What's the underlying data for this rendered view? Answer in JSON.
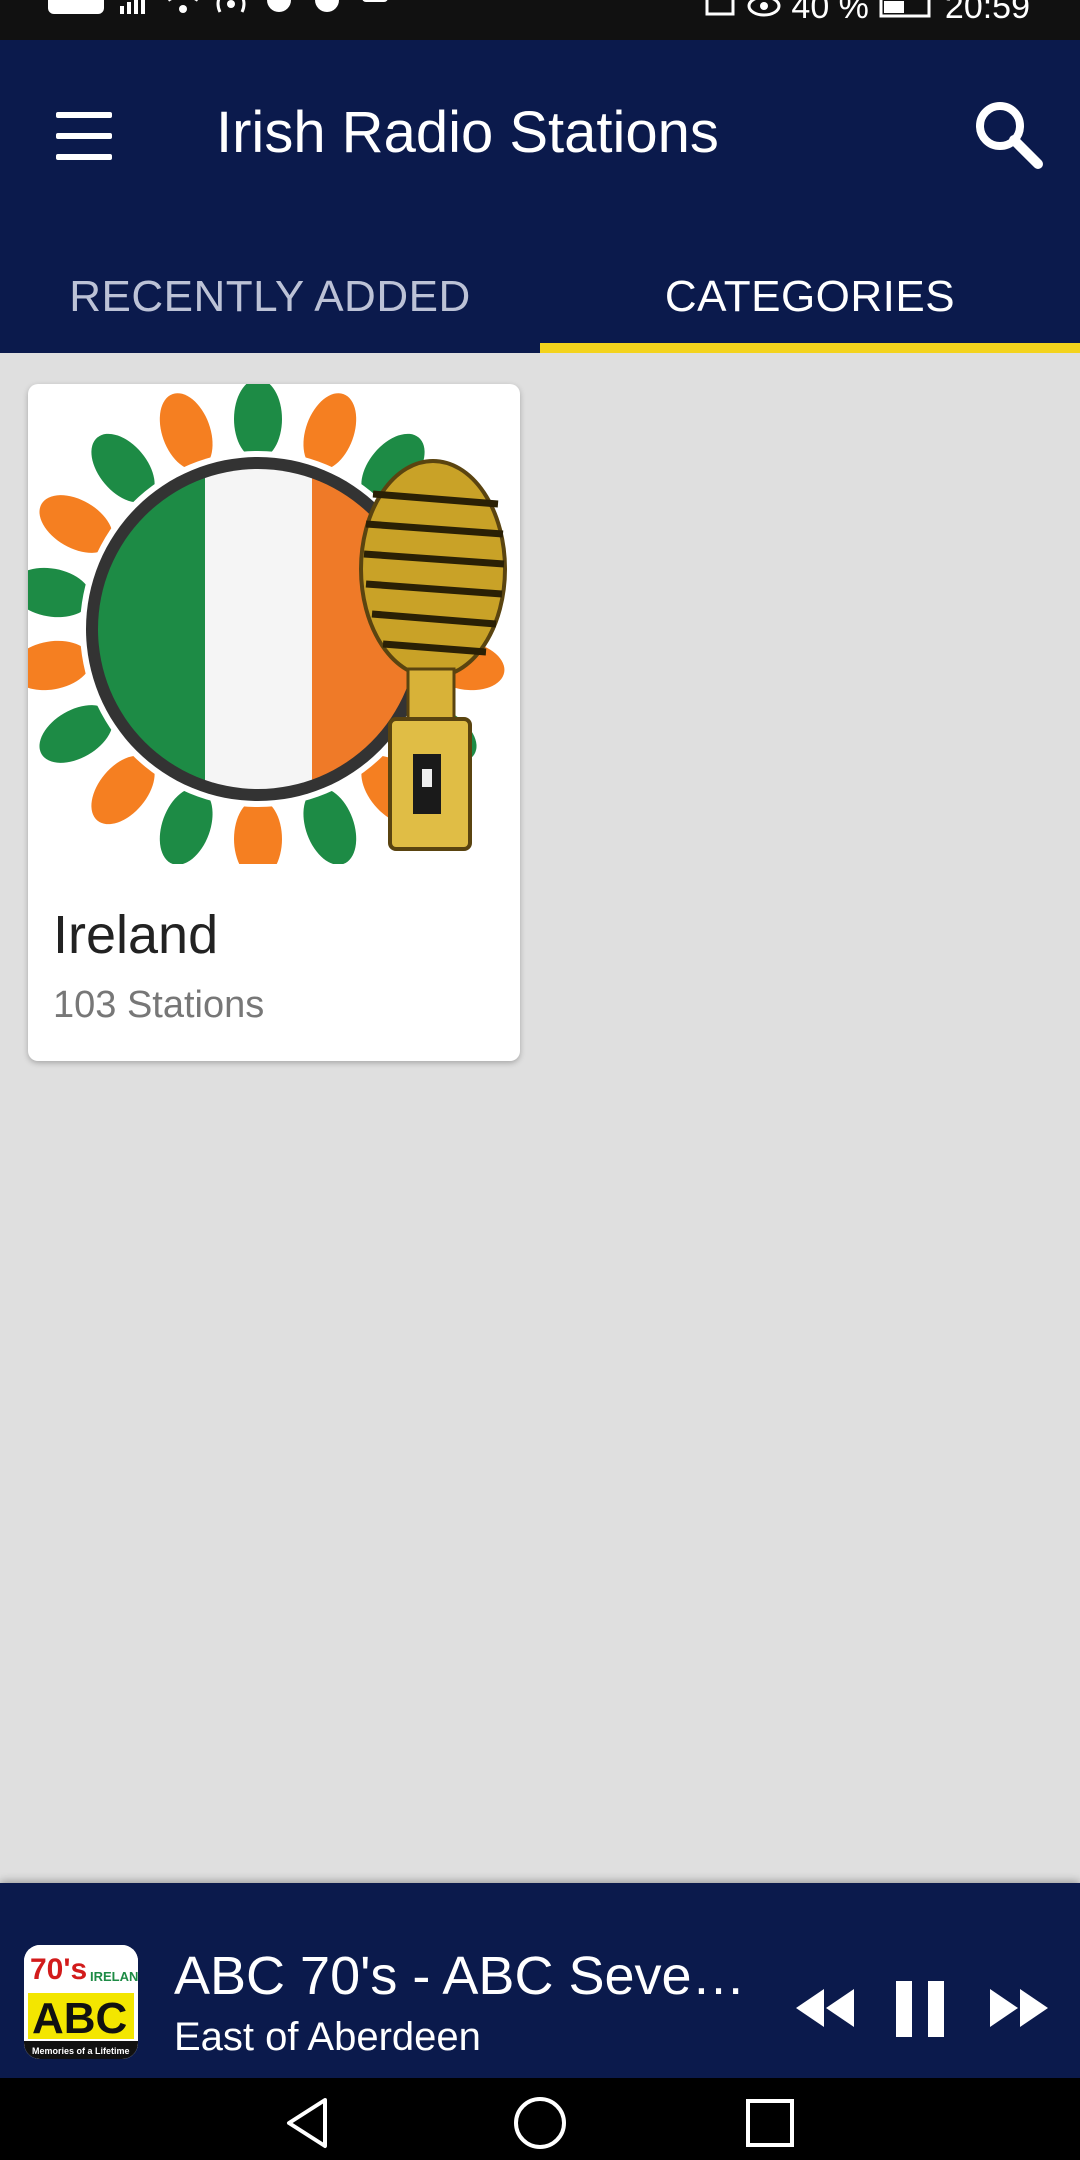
{
  "app": {
    "title": "Irish Radio Stations"
  },
  "status_bar": {
    "battery": "40 %",
    "time": "20:59"
  },
  "tabs": [
    {
      "label": "RECENTLY ADDED",
      "active": false
    },
    {
      "label": "CATEGORIES",
      "active": true
    }
  ],
  "categories": [
    {
      "name": "Ireland",
      "count": "103 Stations"
    }
  ],
  "player": {
    "title": "ABC 70's - ABC Sevent...",
    "subtitle": "East of Aberdeen",
    "logo_text": {
      "top": "70's",
      "tag": "IRELAND",
      "main": "ABC",
      "foot": "Memories of a Lifetime"
    },
    "controls": [
      "rewind-icon",
      "pause-icon",
      "fast-forward-icon"
    ]
  },
  "icons": [
    "menu-icon",
    "search-icon",
    "back-icon",
    "home-icon",
    "recents-icon"
  ],
  "colors": {
    "appbar": "#0b1a4c",
    "accent": "#f3d31d",
    "background": "#dfdfdf"
  }
}
